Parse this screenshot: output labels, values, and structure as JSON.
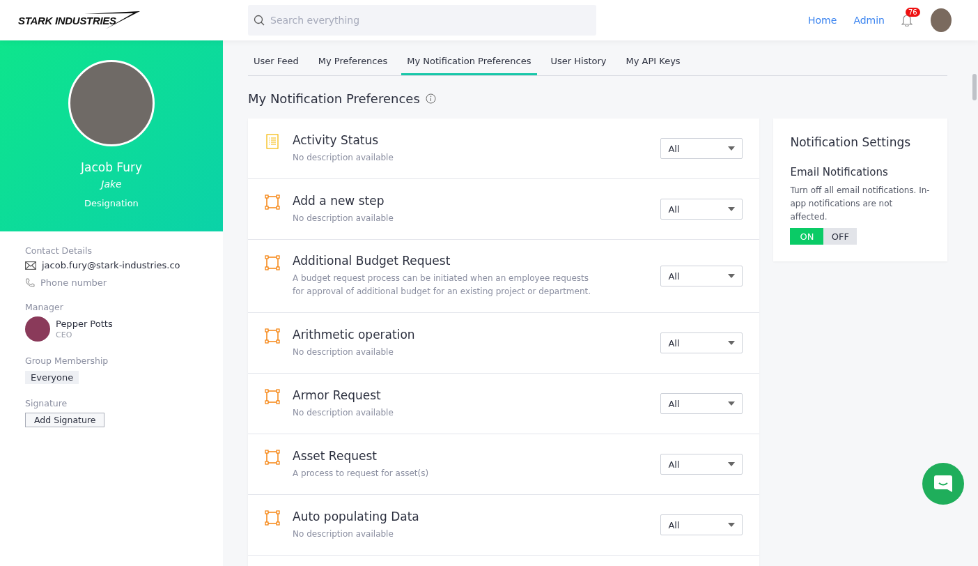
{
  "header": {
    "logo": "STARK INDUSTRIES",
    "search": {
      "placeholder": "Search everything"
    },
    "nav": [
      "Home",
      "Admin"
    ],
    "notification_count": "76"
  },
  "profile": {
    "name": "Jacob Fury",
    "nickname": "Jake",
    "designation": "Designation"
  },
  "contact": {
    "heading": "Contact Details",
    "email": "jacob.fury@stark-industries.co",
    "phone": "Phone number"
  },
  "manager": {
    "heading": "Manager",
    "name": "Pepper Potts",
    "title": "CEO"
  },
  "groups": {
    "heading": "Group Membership",
    "items": [
      "Everyone"
    ]
  },
  "signature": {
    "heading": "Signature",
    "button": "Add Signature"
  },
  "tabs": [
    {
      "label": "User Feed",
      "selected": false
    },
    {
      "label": "My Preferences",
      "selected": false
    },
    {
      "label": "My Notification Preferences",
      "selected": true
    },
    {
      "label": "User History",
      "selected": false
    },
    {
      "label": "My API Keys",
      "selected": false
    }
  ],
  "page_title": "My Notification Preferences",
  "preferences": [
    {
      "kind": "list",
      "title": "Activity Status",
      "description": "No description available",
      "value": "All"
    },
    {
      "kind": "process",
      "title": "Add a new step",
      "description": "No description available",
      "value": "All"
    },
    {
      "kind": "process",
      "title": "Additional Budget Request",
      "description": "A budget request process can be initiated when an employee requests for approval of additional budget for an existing project or department.",
      "value": "All"
    },
    {
      "kind": "process",
      "title": "Arithmetic operation",
      "description": "No description available",
      "value": "All"
    },
    {
      "kind": "process",
      "title": "Armor Request",
      "description": "No description available",
      "value": "All"
    },
    {
      "kind": "process",
      "title": "Asset Request",
      "description": "A process to request for asset(s)",
      "value": "All"
    },
    {
      "kind": "process",
      "title": "Auto populating Data",
      "description": "No description available",
      "value": "All"
    }
  ],
  "settings": {
    "title": "Notification Settings",
    "heading": "Email Notifications",
    "description": "Turn off all email notifications. In-app notifications are not affected.",
    "toggle": [
      {
        "label": "ON",
        "selected": true
      },
      {
        "label": "OFF",
        "selected": false
      }
    ]
  }
}
